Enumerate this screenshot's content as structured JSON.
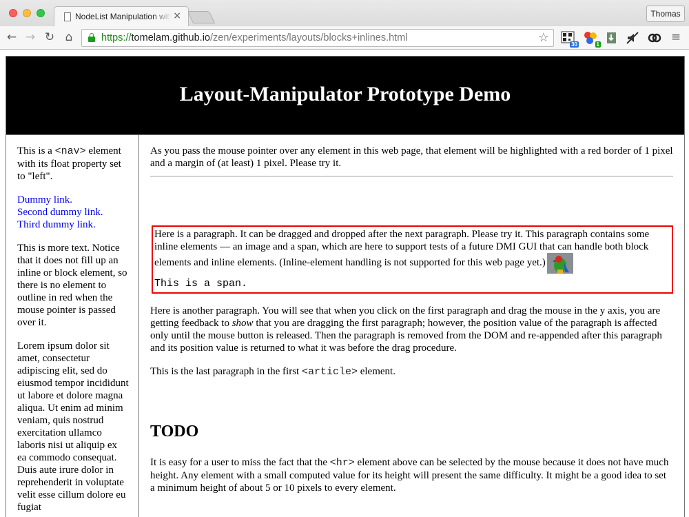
{
  "browser": {
    "tab_title": "NodeList Manipulation with",
    "tab_close": "×",
    "user_button": "Thomas",
    "url_scheme": "https://",
    "url_host": "tomelam.github.io",
    "url_path": "/zen/experiments/layouts/blocks+inlines.html",
    "back": "←",
    "forward": "→",
    "reload": "↻",
    "home": "⌂",
    "star": "☆",
    "menu": "≡",
    "extensions": [
      {
        "name": "qr-extension-icon",
        "badge": "30",
        "badge_color": "#2a6fdb"
      },
      {
        "name": "balls-extension-icon",
        "badge": "1",
        "badge_color": "#1a9a1a"
      },
      {
        "name": "download-extension-icon",
        "badge": "",
        "badge_color": ""
      },
      {
        "name": "mute-extension-icon",
        "badge": "",
        "badge_color": ""
      },
      {
        "name": "link-extension-icon",
        "badge": "",
        "badge_color": ""
      }
    ]
  },
  "page": {
    "title": "Layout-Manipulator Prototype Demo",
    "nav": {
      "intro_pre": "This is a ",
      "intro_code": "<nav>",
      "intro_post": " element with its float property set to \"left\".",
      "links": [
        "Dummy link.",
        "Second dummy link.",
        "Third dummy link."
      ],
      "more_text": "This is more text. Notice that it does not fill up an inline or block element, so there is no element to outline in red when the mouse pointer is passed over it.",
      "lorem": "Lorem ipsum dolor sit amet, consectetur adipiscing elit, sed do eiusmod tempor incididunt ut labore et dolore magna aliqua. Ut enim ad minim veniam, quis nostrud exercitation ullamco laboris nisi ut aliquip ex ea commodo consequat. Duis aute irure dolor in reprehenderit in voluptate velit esse cillum dolore eu fugiat"
    },
    "main": {
      "intro": "As you pass the mouse pointer over any element in this web page, that element will be highlighted with a red border of 1 pixel and a margin of (at least) 1 pixel. Please try it.",
      "para1": "Here is a paragraph. It can be dragged and dropped after the next paragraph. Please try it. This paragraph contains some inline elements — an image and a span, which are here to support tests of a future DMI GUI that can handle both block elements and inline elements. (Inline-element handling is not supported for this web page yet.)",
      "span_text": "This is a span.",
      "para2_pre": "Here is another paragraph. You will see that when you click on the first paragraph and drag the mouse in the y axis, you are getting feedback to ",
      "para2_em": "show",
      "para2_post": " that you are dragging the first paragraph; however, the position value of the paragraph is affected only until the mouse button is released. Then the paragraph is removed from the DOM and re-appended after this paragraph and its position value is returned to what it was before the drag procedure.",
      "para3_pre": "This is the last paragraph in the first ",
      "para3_code": "<article>",
      "para3_post": " element.",
      "todo_heading": "TODO",
      "para4_pre": "It is easy for a user to miss the fact that the ",
      "para4_code": "<hr>",
      "para4_post": " element above can be selected by the mouse because it does not have much height. Any element with a small computed value for its height will present the same difficulty. It might be a good idea to set a minimum height of about 5 or 10 pixels to every element."
    },
    "highlight_color": "#ee0000"
  }
}
